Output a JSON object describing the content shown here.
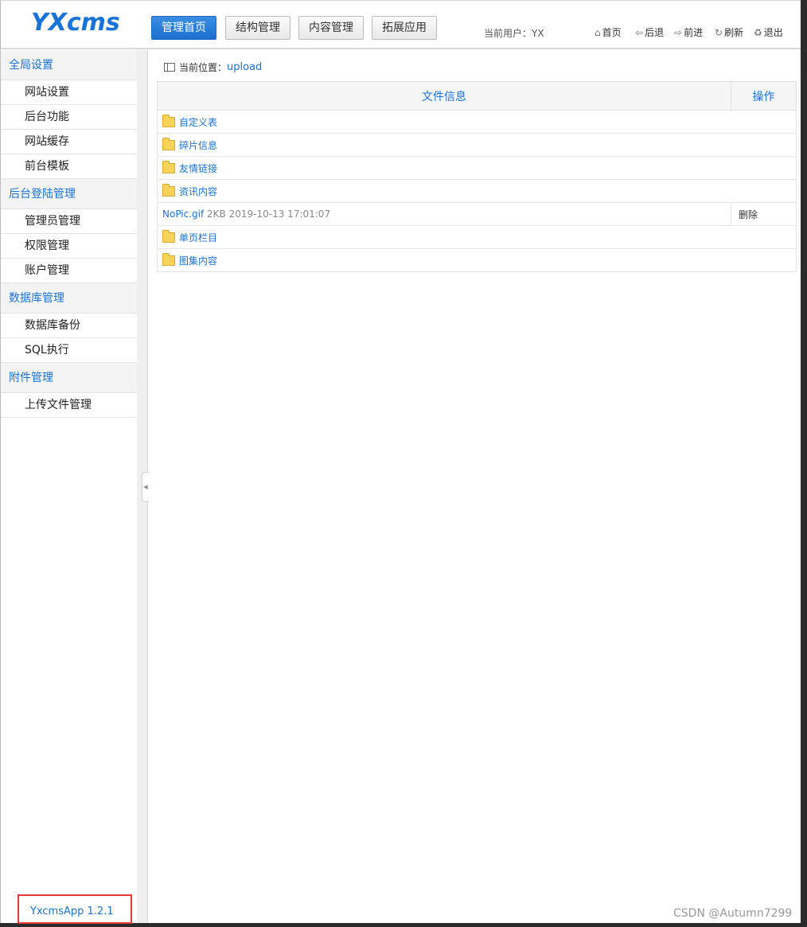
{
  "header": {
    "logo": "YXcms",
    "nav": [
      "管理首页",
      "结构管理",
      "内容管理",
      "拓展应用"
    ],
    "active_nav": "管理首页",
    "current_user_label": "当前用户：YX",
    "tools": [
      {
        "icon": "home-icon",
        "glyph": "⌂",
        "label": "首页"
      },
      {
        "icon": "back-arrow-icon",
        "glyph": "⇦",
        "label": "后退"
      },
      {
        "icon": "forward-arrow-icon",
        "glyph": "⇨",
        "label": "前进"
      },
      {
        "icon": "refresh-icon",
        "glyph": "↻",
        "label": "刷新"
      },
      {
        "icon": "exit-icon",
        "glyph": "♻",
        "label": "退出"
      }
    ]
  },
  "sidebar": {
    "groups": [
      {
        "title": "全局设置",
        "items": [
          "网站设置",
          "后台功能",
          "网站缓存",
          "前台模板"
        ]
      },
      {
        "title": "后台登陆管理",
        "items": [
          "管理员管理",
          "权限管理",
          "账户管理"
        ]
      },
      {
        "title": "数据库管理",
        "items": [
          "数据库备份",
          "SQL执行"
        ]
      },
      {
        "title": "附件管理",
        "items": [
          "上传文件管理"
        ]
      }
    ],
    "version": "YxcmsApp 1.2.1"
  },
  "breadcrumb": {
    "label": "当前位置：",
    "path": "upload"
  },
  "table": {
    "headers": {
      "info": "文件信息",
      "action": "操作"
    },
    "rows": [
      {
        "type": "folder",
        "name": "自定义表"
      },
      {
        "type": "folder",
        "name": "碎片信息"
      },
      {
        "type": "folder",
        "name": "友情链接"
      },
      {
        "type": "folder",
        "name": "资讯内容"
      },
      {
        "type": "file",
        "name": "NoPic.gif",
        "size": "2KB",
        "date": "2019-10-13 17:01:07",
        "action": "删除"
      },
      {
        "type": "folder",
        "name": "单页栏目"
      },
      {
        "type": "folder",
        "name": "图集内容"
      }
    ]
  },
  "watermark": "CSDN @Autumn7299"
}
